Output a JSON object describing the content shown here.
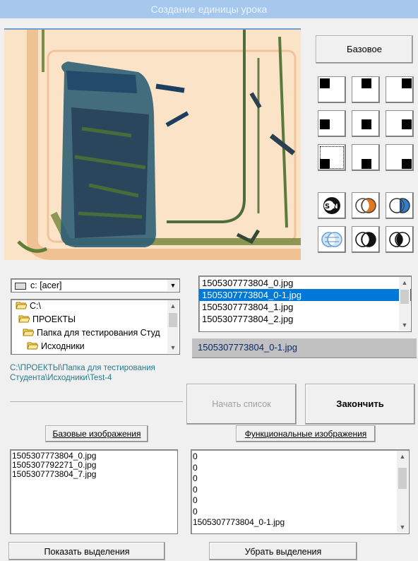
{
  "window": {
    "title": "Создание единицы урока"
  },
  "toolbar": {
    "base_button": "Базовое"
  },
  "drive": {
    "value": "c: [acer]"
  },
  "tree": {
    "items": [
      "C:\\",
      "ПРОЕКТЫ",
      "Папка для тестирования Студ",
      "Исходники"
    ]
  },
  "files": {
    "items": [
      "1505307773804_0.jpg",
      "1505307773804_0-1.jpg",
      "1505307773804_1.jpg",
      "1505307773804_2.jpg"
    ],
    "selected_index": 1,
    "selected_value": "1505307773804_0-1.jpg"
  },
  "path": {
    "line1": "C:\\ПРОЕКТЫ\\Папка для тестирования",
    "line2": "Студента\\Исходники\\Test-4"
  },
  "actions": {
    "start_list": "Начать список",
    "finish": "Закончить"
  },
  "base_images": {
    "header": "Базовые изображения",
    "items": [
      "1505307773804_0.jpg",
      "1505307792271_0.jpg",
      "1505307773804_7.jpg"
    ]
  },
  "func_images": {
    "header": "Функциональные изображения",
    "items": [
      "0",
      "0",
      "0",
      "0",
      "0",
      "0",
      "1505307773804_0-1.jpg"
    ]
  },
  "bottom": {
    "show_selection": "Показать выделения",
    "remove_selection": "Убрать выделения"
  },
  "colors": {
    "title_bar": "#a6c8ec",
    "selection": "#0078d7",
    "path_text": "#2a7a8a",
    "orange": "#e2761d",
    "blue": "#2f7fd0"
  },
  "icons": [
    "sen-icon",
    "orange-circles-icon",
    "blue-circles-icon",
    "lens-icon",
    "black-white-circles-icon",
    "dark-circles-icon"
  ]
}
